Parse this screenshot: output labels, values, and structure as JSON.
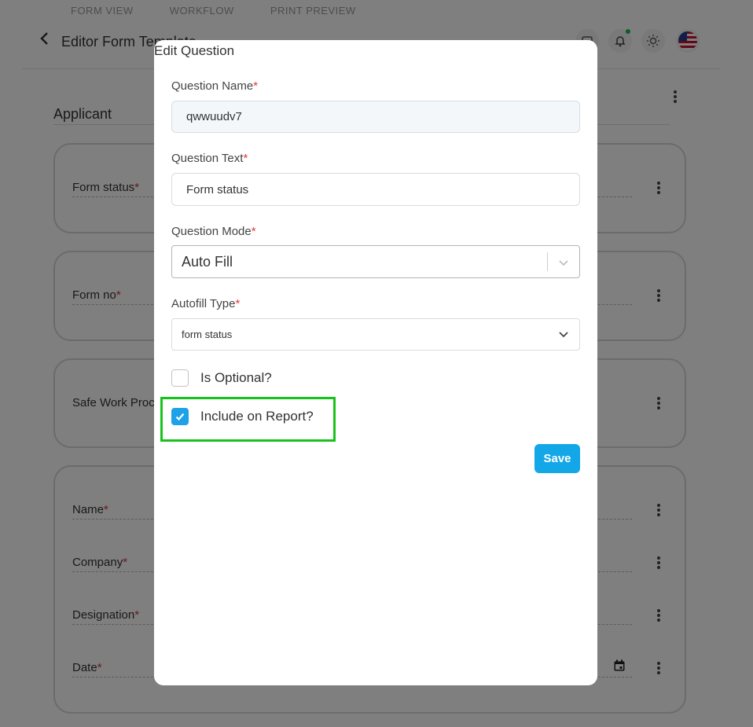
{
  "background": {
    "tabs": [
      "FORM VIEW",
      "WORKFLOW",
      "PRINT PREVIEW"
    ],
    "header": {
      "title": "Editor Form Template"
    },
    "section_title": "Applicant",
    "fields": {
      "form_status": "Form status",
      "form_no": "Form no",
      "safe_work": "Safe Work Proc",
      "name": "Name",
      "company": "Company",
      "designation": "Designation",
      "date": "Date"
    },
    "required_mark": "*"
  },
  "modal": {
    "title": "Edit Question",
    "required_mark": "*",
    "question_name": {
      "label": "Question Name",
      "value": "qwwuudv7"
    },
    "question_text": {
      "label": "Question Text",
      "value": "Form status"
    },
    "question_mode": {
      "label": "Question Mode",
      "value": "Auto Fill"
    },
    "autofill_type": {
      "label": "Autofill Type",
      "value": "form status"
    },
    "is_optional": {
      "label": "Is Optional?",
      "checked": false
    },
    "include_on_report": {
      "label": "Include on Report?",
      "checked": true
    },
    "save_label": "Save"
  },
  "colors": {
    "accent": "#13a7e8",
    "highlight": "#17c21a",
    "required": "#e53935"
  }
}
